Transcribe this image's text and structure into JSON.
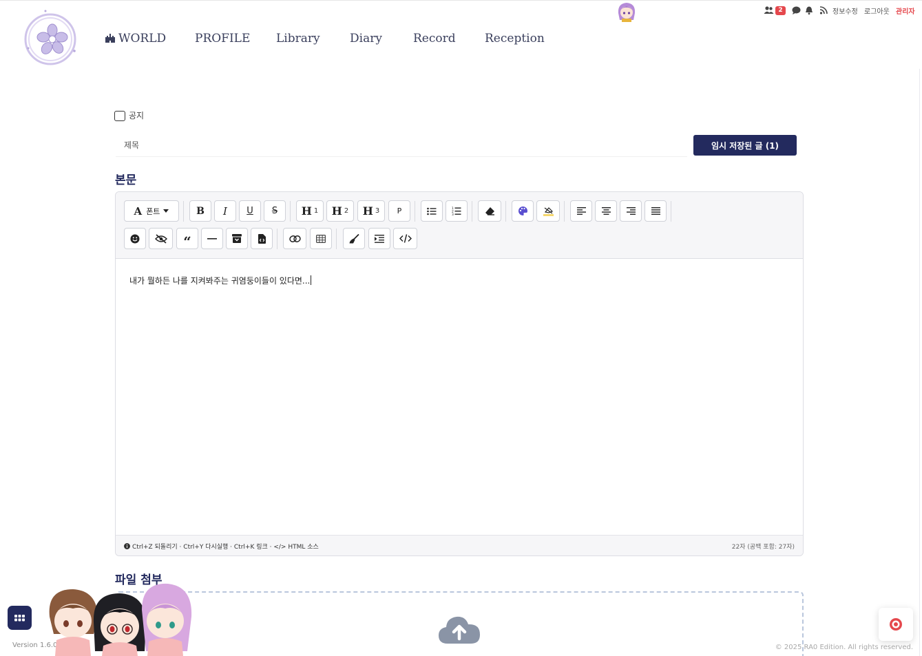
{
  "nav": {
    "items": [
      "WORLD",
      "PROFILE",
      "Library",
      "Diary",
      "Record",
      "Reception"
    ]
  },
  "topbar": {
    "user_count_badge": "2",
    "links": [
      "정보수정",
      "로그아웃",
      "관리자"
    ]
  },
  "form": {
    "notice_label": "공지",
    "title_placeholder": "제목",
    "draft_button": "임시 저장된 글 (1)",
    "body_heading": "본문",
    "attach_heading": "파일 첨부"
  },
  "editor": {
    "font_button": "폰트",
    "heading_buttons": [
      {
        "label": "H",
        "level": "1"
      },
      {
        "label": "H",
        "level": "2"
      },
      {
        "label": "H",
        "level": "3"
      }
    ],
    "paragraph_button": "P",
    "content": "내가 뭘하든 나를 지켜봐주는 귀염둥이들이 있다면...",
    "shortcuts_hint": "Ctrl+Z 되돌리기 · Ctrl+Y 다시실행 · Ctrl+K 링크 · </> HTML 소스",
    "char_count": "22자 (공백 포함: 27자)"
  },
  "footer": {
    "version": "Version 1.6.0",
    "copyright": "© 2025 RA0 Edition. All rights reserved."
  },
  "colors": {
    "primary": "#232a5e",
    "accent_red": "#e5484d",
    "logo_lilac": "#b7a8dc",
    "dropzone_border": "#b9c6dc",
    "cloud": "#8a94a6"
  }
}
